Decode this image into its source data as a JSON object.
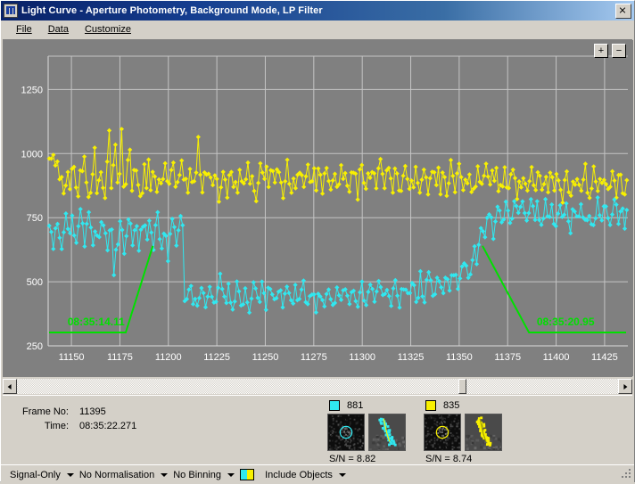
{
  "window": {
    "title": "Light Curve - Aperture Photometry, Background Mode, LP Filter",
    "app_icon": "chart-bars-icon",
    "close_label": "✕"
  },
  "menu": {
    "items": [
      {
        "label": "File"
      },
      {
        "label": "Data"
      },
      {
        "label": "Customize"
      }
    ]
  },
  "chart_controls": {
    "zoom_in": "+",
    "zoom_out": "−"
  },
  "annotations": {
    "left_time": "08:35:14.11",
    "right_time": "08:35:20.95",
    "color": "#00e000"
  },
  "info": {
    "frame_label": "Frame No:",
    "frame_value": "11395",
    "time_label": "Time:",
    "time_value": "08:35:22.271"
  },
  "objects": [
    {
      "id": "881",
      "color": "#30e8f0",
      "sn_label": "S/N =",
      "sn_value": "8.82",
      "thumb_aperture": "star-aperture-thumbnail",
      "thumb_track": "object-track-thumbnail"
    },
    {
      "id": "835",
      "color": "#f8f000",
      "sn_label": "S/N =",
      "sn_value": "8.74",
      "thumb_aperture": "star-aperture-thumbnail",
      "thumb_track": "object-track-thumbnail"
    }
  ],
  "statusbar": {
    "signal_mode": "Signal-Only",
    "normalisation": "No Normalisation",
    "binning": "No Binning",
    "include_objects": "Include Objects",
    "swatch_colors": [
      "#30e8f0",
      "#f8f000"
    ]
  },
  "chart_data": {
    "type": "line",
    "title": "",
    "xlabel": "",
    "ylabel": "",
    "xlim": [
      11138,
      11437
    ],
    "ylim": [
      250,
      1380
    ],
    "xticks": [
      11150,
      11175,
      11200,
      11225,
      11250,
      11275,
      11300,
      11325,
      11350,
      11375,
      11400,
      11425
    ],
    "yticks": [
      250,
      500,
      750,
      1000,
      1250
    ],
    "grid": true,
    "background": "#808080",
    "grid_color": "#c4c4c4",
    "legend": "object-swatches-below",
    "series": [
      {
        "name": "835",
        "color": "#f8f000",
        "marker": "diamond",
        "values": [
          1005,
          975,
          1000,
          930,
          955,
          890,
          940,
          860,
          905,
          950,
          880,
          920,
          965,
          885,
          845,
          930,
          900,
          955,
          880,
          830,
          870,
          920,
          1010,
          860,
          890,
          940,
          895,
          820,
          945,
          1065,
          900,
          960,
          1010,
          880,
          940,
          1090,
          905,
          860,
          940,
          1000,
          870,
          910,
          965,
          900,
          845,
          880,
          935,
          890,
          955,
          860,
          900,
          945,
          880,
          905,
          860,
          930,
          975,
          890,
          850,
          905,
          945,
          895,
          860,
          915,
          955,
          880,
          905,
          870,
          930,
          905,
          860,
          950,
          1060,
          900,
          870,
          930,
          890,
          955,
          900,
          865,
          925,
          880,
          840,
          900,
          945,
          895,
          860,
          910,
          950,
          880,
          905,
          865,
          925,
          890,
          860,
          915,
          950,
          900,
          940,
          880,
          845,
          905,
          960,
          900,
          870,
          925,
          890,
          940,
          900,
          860,
          915,
          955,
          890,
          850,
          905,
          945,
          900,
          865,
          925,
          880,
          905,
          945,
          890,
          855,
          910,
          950,
          895,
          865,
          920,
          880,
          935,
          900,
          860,
          905,
          945,
          890,
          855,
          915,
          950,
          900,
          870,
          925,
          885,
          940,
          900,
          860,
          905,
          950,
          890,
          850,
          910,
          945,
          895,
          860,
          920,
          880,
          935,
          900,
          865,
          910,
          950,
          890,
          850,
          905,
          940,
          895,
          860,
          915,
          955,
          890,
          855,
          910,
          945,
          900,
          865,
          920,
          880,
          930,
          895,
          855,
          905,
          945,
          885,
          850,
          910,
          950,
          895,
          860,
          915,
          875,
          930,
          890,
          855,
          905,
          940,
          890,
          850,
          905,
          945,
          890,
          855,
          915,
          875,
          925,
          885,
          850,
          900,
          940,
          885,
          850,
          905,
          945,
          890,
          855,
          910,
          870,
          925,
          885,
          845,
          900,
          935,
          880,
          845,
          900,
          940,
          885,
          850,
          905,
          865,
          920,
          880,
          845,
          895,
          935,
          880,
          845,
          900,
          940,
          885,
          850,
          905,
          865,
          915,
          875,
          840,
          890,
          930,
          875,
          840,
          895,
          935,
          880,
          845,
          900,
          860,
          910,
          870,
          835,
          885,
          925,
          870,
          835,
          890,
          930,
          875,
          840,
          895,
          855,
          905,
          865,
          830,
          880,
          920,
          865,
          830,
          885,
          925,
          870,
          835,
          890
        ]
      },
      {
        "name": "881",
        "color": "#30e8f0",
        "marker": "diamond",
        "note": "Eclipse: drops from ~720 to ~410 near frame 11192, recovers near frame 11362",
        "values": [
          730,
          690,
          660,
          710,
          745,
          680,
          625,
          700,
          760,
          700,
          655,
          725,
          690,
          640,
          700,
          750,
          700,
          655,
          720,
          770,
          705,
          660,
          730,
          690,
          645,
          700,
          755,
          700,
          650,
          720,
          690,
          540,
          600,
          670,
          720,
          680,
          635,
          700,
          750,
          700,
          655,
          720,
          690,
          640,
          700,
          745,
          700,
          655,
          715,
          690,
          645,
          700,
          750,
          700,
          650,
          715,
          685,
          600,
          660,
          720,
          690,
          640,
          700,
          750,
          700,
          430,
          420,
          450,
          480,
          440,
          400,
          430,
          460,
          490,
          440,
          410,
          445,
          475,
          435,
          405,
          440,
          470,
          500,
          450,
          415,
          445,
          475,
          435,
          405,
          440,
          470,
          440,
          410,
          445,
          475,
          440,
          410,
          445,
          475,
          440,
          405,
          440,
          470,
          440,
          410,
          445,
          480,
          445,
          410,
          445,
          475,
          440,
          410,
          445,
          475,
          440,
          405,
          440,
          470,
          440,
          410,
          445,
          480,
          445,
          415,
          450,
          480,
          445,
          410,
          445,
          475,
          440,
          410,
          450,
          480,
          445,
          415,
          450,
          485,
          450,
          415,
          450,
          480,
          445,
          415,
          455,
          485,
          450,
          420,
          455,
          485,
          450,
          420,
          460,
          490,
          455,
          420,
          455,
          490,
          455,
          425,
          460,
          495,
          460,
          425,
          460,
          495,
          460,
          430,
          465,
          500,
          465,
          430,
          470,
          505,
          470,
          435,
          470,
          510,
          475,
          440,
          480,
          515,
          480,
          445,
          485,
          520,
          485,
          450,
          490,
          530,
          495,
          455,
          500,
          540,
          505,
          465,
          510,
          550,
          580,
          540,
          500,
          560,
          610,
          640,
          600,
          650,
          690,
          720,
          690,
          730,
          760,
          730,
          700,
          745,
          780,
          750,
          720,
          760,
          790,
          760,
          730,
          775,
          800,
          770,
          740,
          780,
          810,
          780,
          745,
          785,
          815,
          780,
          750,
          790,
          760,
          730,
          770,
          800,
          770,
          740,
          780,
          750,
          720,
          765,
          795,
          765,
          735,
          775,
          745,
          715,
          760,
          790,
          760,
          730,
          770,
          740,
          710,
          755,
          785,
          755,
          725,
          765,
          800,
          770,
          740,
          780,
          810,
          780,
          750,
          790,
          820,
          790,
          760,
          800,
          770,
          740,
          780
        ]
      }
    ]
  }
}
